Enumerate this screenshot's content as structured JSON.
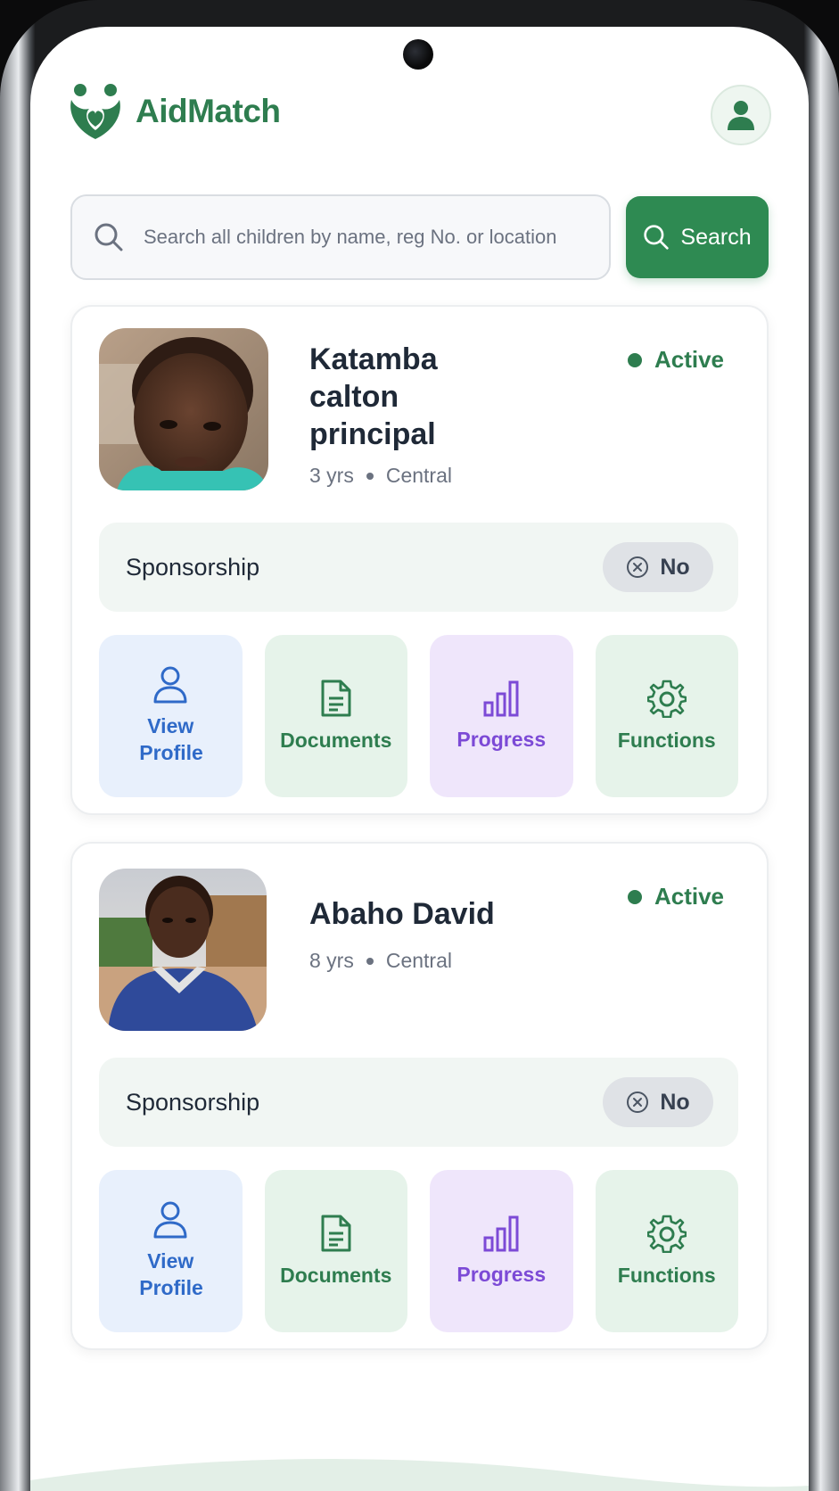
{
  "app": {
    "name": "AidMatch"
  },
  "search": {
    "placeholder": "Search all children by name, reg No. or location",
    "button_label": "Search"
  },
  "children": [
    {
      "name": "Katamba calton principal",
      "age": "3 yrs",
      "region": "Central",
      "status": "Active",
      "sponsorship_label": "Sponsorship",
      "sponsorship_value": "No",
      "actions": {
        "view_profile": "View Profile",
        "documents": "Documents",
        "progress": "Progress",
        "functions": "Functions"
      }
    },
    {
      "name": "Abaho David",
      "age": "8 yrs",
      "region": "Central",
      "status": "Active",
      "sponsorship_label": "Sponsorship",
      "sponsorship_value": "No",
      "actions": {
        "view_profile": "View Profile",
        "documents": "Documents",
        "progress": "Progress",
        "functions": "Functions"
      }
    }
  ],
  "colors": {
    "brand": "#2e7d4f",
    "search_button": "#2e8a52",
    "profile_accent": "#2f6ac8",
    "progress_accent": "#7c4ad6"
  },
  "icons": [
    "logo-heart-people-icon",
    "user-icon",
    "search-icon",
    "close-circle-icon",
    "document-icon",
    "bar-chart-icon",
    "gear-icon"
  ]
}
